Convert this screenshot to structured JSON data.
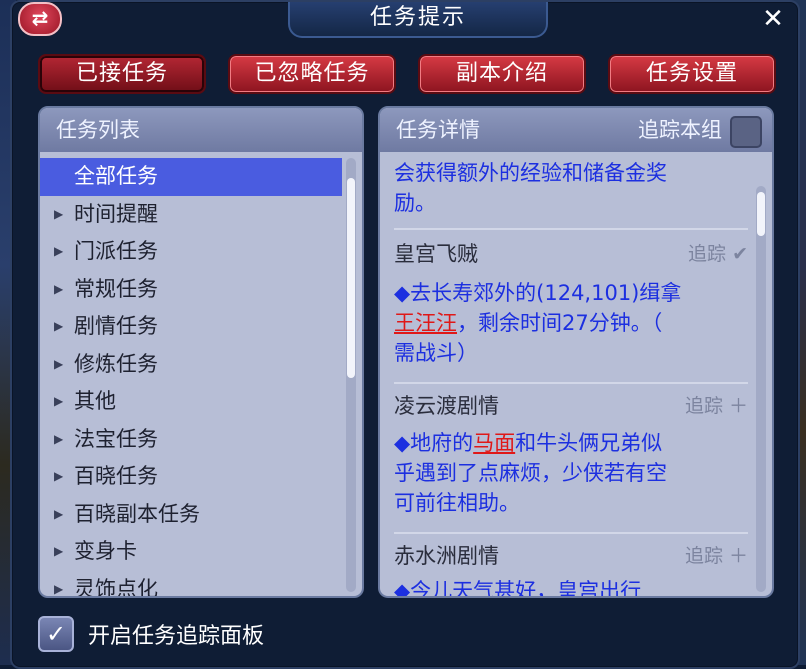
{
  "window": {
    "title": "任务提示",
    "close_symbol": "✕",
    "swap_symbol": "⇄"
  },
  "tabs": [
    {
      "label": "已接任务",
      "active": true
    },
    {
      "label": "已忽略任务",
      "active": false
    },
    {
      "label": "副本介绍",
      "active": false
    },
    {
      "label": "任务设置",
      "active": false
    }
  ],
  "task_list": {
    "header": "任务列表",
    "items": [
      {
        "label": "全部任务",
        "selected": true
      },
      {
        "label": "时间提醒"
      },
      {
        "label": "门派任务"
      },
      {
        "label": "常规任务"
      },
      {
        "label": "剧情任务"
      },
      {
        "label": "修炼任务"
      },
      {
        "label": "其他"
      },
      {
        "label": "法宝任务"
      },
      {
        "label": "百晓任务"
      },
      {
        "label": "百晓副本任务"
      },
      {
        "label": "变身卡"
      },
      {
        "label": "灵饰点化"
      }
    ]
  },
  "task_detail": {
    "header": "任务详情",
    "track_group_label": "追踪本组",
    "intro_line1": "会获得额外的经验和储备金奖",
    "intro_line2": "励。",
    "entries": [
      {
        "title": "皇宫飞贼",
        "track": "追踪 ✔",
        "line1": "◆去长寿郊外的(124,101)缉拿",
        "highlight": "王汪汪",
        "line2_rest": "，剩余时间27分钟。（",
        "line3": "需战斗）"
      },
      {
        "title": "凌云渡剧情",
        "track": "追踪 ＋",
        "line1_pre": "◆地府的",
        "highlight": "马面",
        "line1_post": "和牛头俩兄弟似",
        "line2": "乎遇到了点麻烦，少侠若有空",
        "line3": "可前往相助。"
      },
      {
        "title": "赤水洲剧情",
        "track": "追踪 ＋",
        "line1": "◆今儿天气甚好，皇宫出行"
      }
    ]
  },
  "footer": {
    "checkbox_checked": true,
    "check_symbol": "✓",
    "label": "开启任务追踪面板"
  },
  "colors": {
    "tab_red": "#c02a36",
    "highlight_blue": "#1c2fe0",
    "highlight_red": "#e01818",
    "selected_row": "#4a5ce0"
  }
}
